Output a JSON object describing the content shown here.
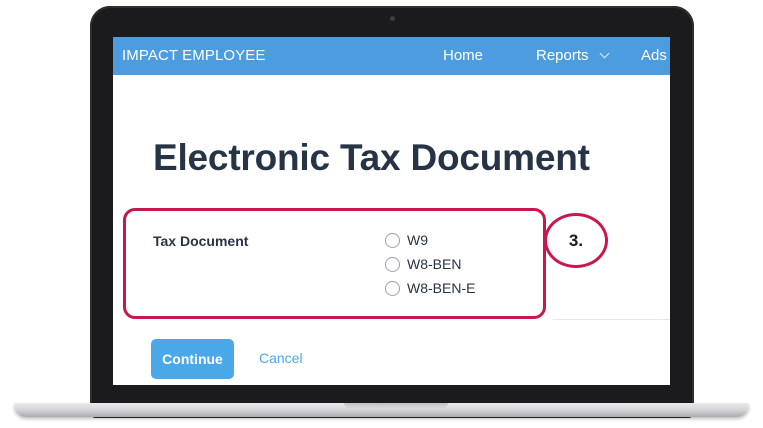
{
  "app": {
    "brand": "IMPACT EMPLOYEE"
  },
  "nav": {
    "home": "Home",
    "reports": "Reports",
    "ads": "Ads"
  },
  "page": {
    "title": "Electronic Tax Document"
  },
  "form": {
    "tax_document": {
      "label": "Tax Document",
      "options": [
        {
          "label": "W9",
          "selected": false
        },
        {
          "label": "W8-BEN",
          "selected": false
        },
        {
          "label": "W8-BEN-E",
          "selected": false
        }
      ]
    },
    "continue_label": "Continue",
    "cancel_label": "Cancel"
  },
  "annotation": {
    "step": "3."
  },
  "colors": {
    "navbar": "#4d9ce0",
    "accent": "#4aa8e8",
    "highlight": "#c8174f",
    "title_text": "#263445"
  },
  "icons": [
    "chevron-down-icon",
    "radio-icon"
  ]
}
